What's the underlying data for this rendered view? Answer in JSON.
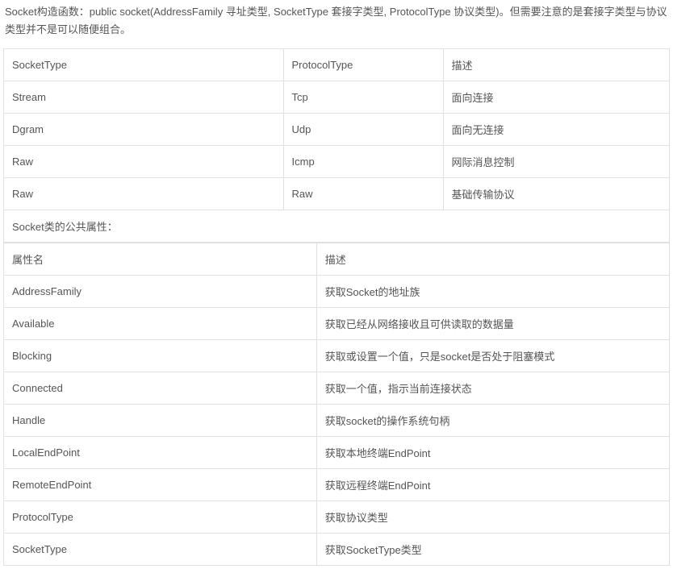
{
  "intro": "Socket构造函数：public socket(AddressFamily 寻址类型, SocketType 套接字类型, ProtocolType 协议类型)。但需要注意的是套接字类型与协议类型并不是可以随便组合。",
  "table1": {
    "headers": [
      "SocketType",
      "ProtocolType",
      "描述"
    ],
    "rows": [
      [
        "Stream",
        "Tcp",
        "面向连接"
      ],
      [
        "Dgram",
        "Udp",
        "面向无连接"
      ],
      [
        "Raw",
        "Icmp",
        "网际消息控制"
      ],
      [
        "Raw",
        "Raw",
        "基础传输协议"
      ]
    ]
  },
  "section2_title": "Socket类的公共属性：",
  "table2": {
    "headers": [
      "属性名",
      "描述"
    ],
    "rows": [
      [
        "AddressFamily",
        "获取Socket的地址族"
      ],
      [
        "Available",
        "获取已经从网络接收且可供读取的数据量"
      ],
      [
        "Blocking",
        "获取或设置一个值，只是socket是否处于阻塞模式"
      ],
      [
        "Connected",
        "获取一个值，指示当前连接状态"
      ],
      [
        "Handle",
        "获取socket的操作系统句柄"
      ],
      [
        "LocalEndPoint",
        "获取本地终端EndPoint"
      ],
      [
        "RemoteEndPoint",
        "获取远程终端EndPoint"
      ],
      [
        "ProtocolType",
        "获取协议类型"
      ],
      [
        "SocketType",
        "获取SocketType类型"
      ]
    ]
  }
}
